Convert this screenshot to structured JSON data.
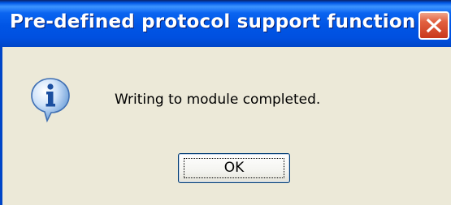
{
  "window": {
    "title": "Pre-defined protocol support function"
  },
  "title_bar": {
    "close_icon": "close-icon",
    "close_color": "#e0502e",
    "bar_color": "#0058e6"
  },
  "content": {
    "icon": "information-icon",
    "message": "Writing to module completed."
  },
  "buttons": {
    "ok_label": "OK"
  },
  "colors": {
    "dialog_background": "#ece9d8",
    "title_text": "#ffffff"
  }
}
